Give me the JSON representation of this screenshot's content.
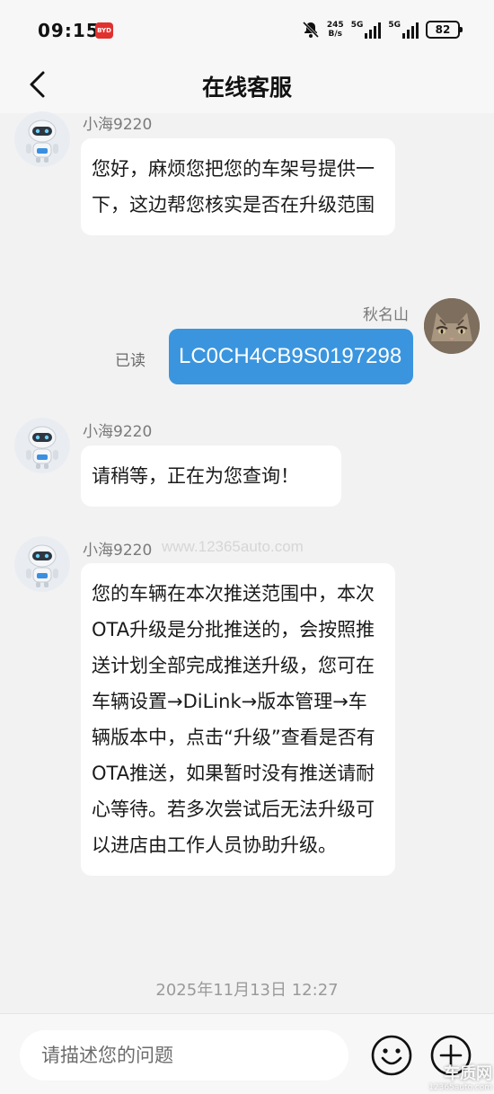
{
  "status_bar": {
    "time": "09:15",
    "app_badge": "BYD",
    "net_speed_value": "245",
    "net_speed_unit": "B/s",
    "sim1_label": "5G",
    "sim2_label": "5G",
    "battery": "82"
  },
  "header": {
    "title": "在线客服"
  },
  "messages": [
    {
      "sender": "小海9220",
      "text": "您好，麻烦您把您的车架号提供一下，这边帮您核实是否在升级范围"
    },
    {
      "sender": "秋名山",
      "text": "LC0CH4CB9S0197298",
      "read_status": "已读"
    },
    {
      "sender": "小海9220",
      "text": "请稍等，正在为您查询！"
    },
    {
      "sender": "小海9220",
      "text": "您的车辆在本次推送范围中，本次OTA升级是分批推送的，会按照推送计划全部完成推送升级，您可在车辆设置→DiLink→版本管理→车辆版本中，点击“升级”查看是否有OTA推送，如果暂时没有推送请耐心等待。若多次尝试后无法升级可以进店由工作人员协助升级。"
    }
  ],
  "timestamp": "2025年11月13日 12:27",
  "watermark": "www.12365auto.com",
  "input": {
    "placeholder": "请描述您的问题"
  },
  "corner_logo": {
    "title": "车质网",
    "url": "12365auto.com"
  },
  "icons": {
    "back": "chevron-left-icon",
    "mute": "bell-off-icon",
    "emoji": "smiley-icon",
    "plus": "plus-circle-icon"
  },
  "colors": {
    "self_bubble": "#3a95de",
    "other_bubble": "#ffffff",
    "background": "#f2f2f2"
  }
}
